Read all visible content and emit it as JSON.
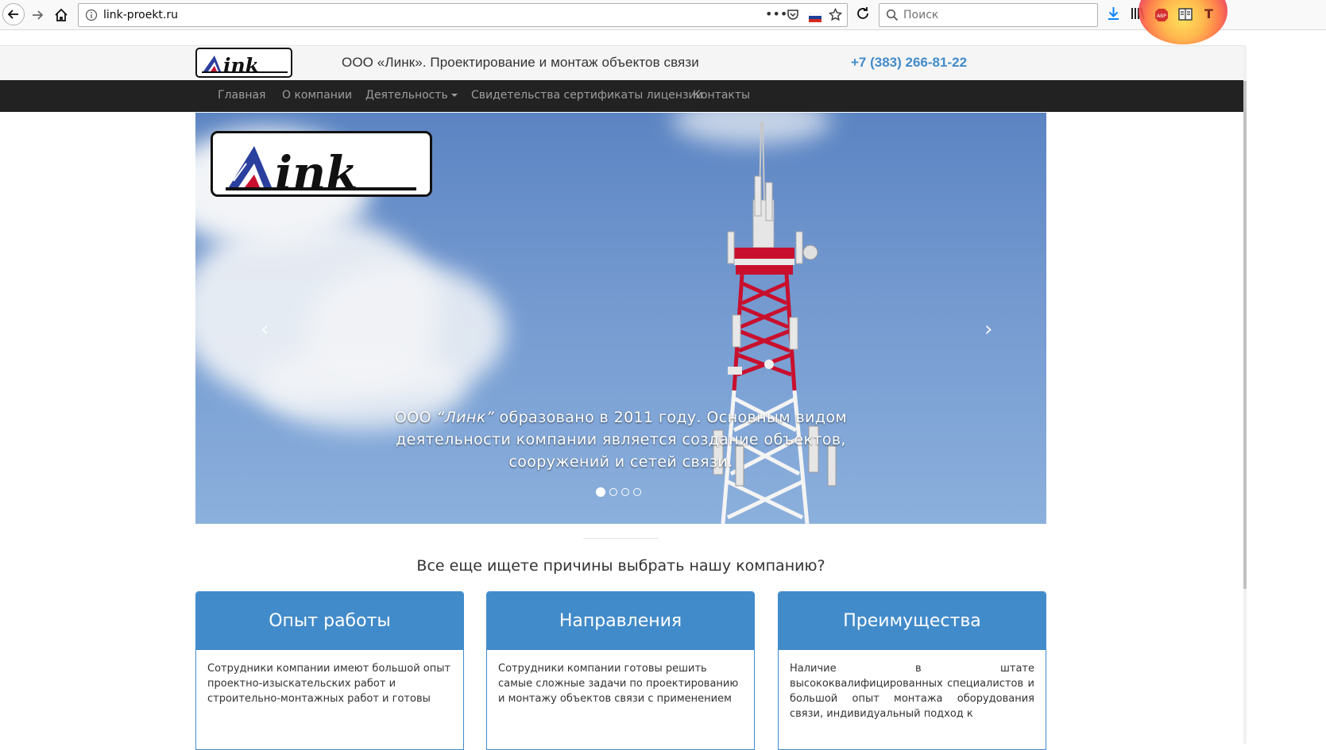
{
  "browser": {
    "url": "link-proekt.ru",
    "search_placeholder": "Поиск"
  },
  "header": {
    "logo_text": "Link",
    "title": "ООО «Линк». Проектирование и монтаж объектов связи",
    "phone": "+7 (383) 266-81-22"
  },
  "nav": {
    "items": [
      {
        "label": "Главная"
      },
      {
        "label": "О компании"
      },
      {
        "label": "Деятельность"
      },
      {
        "label": "Свидетельства сертификаты лицензии"
      },
      {
        "label": "Контакты"
      }
    ]
  },
  "carousel": {
    "caption_prefix": "ООО ",
    "caption_name": "“Линк”",
    "caption_rest": " образовано в 2011 году. Основным видом деятельности компании является создание объектов, сооружений и сетей связи.",
    "slide_count": 4,
    "active_slide": 1,
    "prev_arrow": "‹",
    "next_arrow": "›"
  },
  "section": {
    "title": "Все еще ищете причины выбрать нашу компанию?"
  },
  "cards": [
    {
      "title": "Опыт работы",
      "text": "Сотрудники компании имеют большой опыт проектно-изыскательских работ и строительно-монтажных работ и готовы"
    },
    {
      "title": "Направления",
      "text": "Сотрудники компании готовы решить самые сложные задачи по проектированию и монтажу объектов связи с применением"
    },
    {
      "title": "Преимущества",
      "text": "Наличие в штате высококвалифицированных специалистов и большой опыт монтажа оборудования связи, индивидуальный подход к"
    }
  ],
  "colors": {
    "brand_blue": "#428bca",
    "navbar": "#222222",
    "logo_red": "#c8102e",
    "logo_blue": "#2a3f9e"
  }
}
